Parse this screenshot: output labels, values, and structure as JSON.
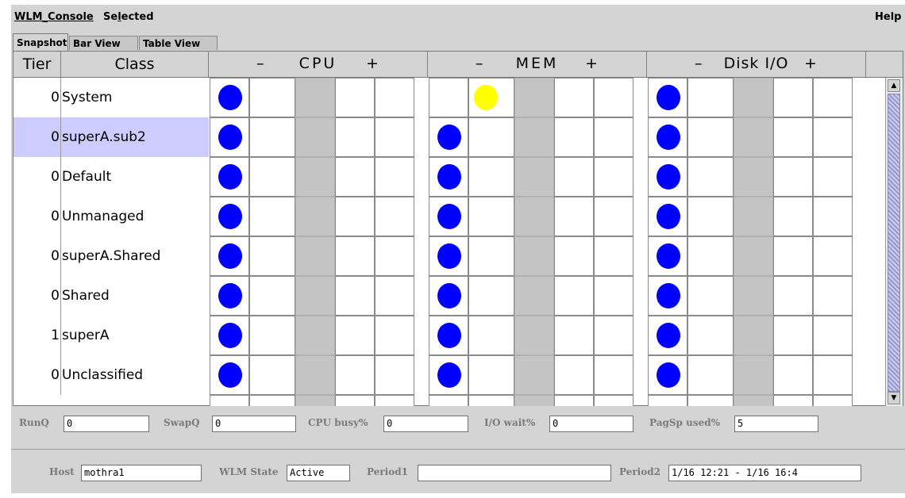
{
  "menubar": {
    "wlm_console": "WLM_Console",
    "selected_pre": "Se",
    "selected_ul": "l",
    "selected_post": "ected",
    "help": "Help"
  },
  "tabs": [
    "Snapshot",
    "Bar View",
    "Table View"
  ],
  "active_tab": "Snapshot",
  "header": {
    "tier": "Tier",
    "class": "Class",
    "groups": [
      {
        "minus": "–",
        "title": "CPU",
        "plus": "+"
      },
      {
        "minus": "–",
        "title": "MEM",
        "plus": "+"
      },
      {
        "minus": "–",
        "title": "Disk I/O",
        "plus": "+"
      }
    ]
  },
  "colors": {
    "blue": "#0000ff",
    "yellow": "#ffff00",
    "selected_row": "#ccccff"
  },
  "rows": [
    {
      "tier": "0",
      "class": "System",
      "selected": false,
      "cpu": {
        "slot": 0,
        "color": "blue"
      },
      "mem": {
        "slot": 1,
        "color": "yellow"
      },
      "disk": {
        "slot": 0,
        "color": "blue"
      }
    },
    {
      "tier": "0",
      "class": "superA.sub2",
      "selected": true,
      "cpu": {
        "slot": 0,
        "color": "blue"
      },
      "mem": {
        "slot": 0,
        "color": "blue"
      },
      "disk": {
        "slot": 0,
        "color": "blue"
      }
    },
    {
      "tier": "0",
      "class": "Default",
      "selected": false,
      "cpu": {
        "slot": 0,
        "color": "blue"
      },
      "mem": {
        "slot": 0,
        "color": "blue"
      },
      "disk": {
        "slot": 0,
        "color": "blue"
      }
    },
    {
      "tier": "0",
      "class": "Unmanaged",
      "selected": false,
      "cpu": {
        "slot": 0,
        "color": "blue"
      },
      "mem": {
        "slot": 0,
        "color": "blue"
      },
      "disk": {
        "slot": 0,
        "color": "blue"
      }
    },
    {
      "tier": "0",
      "class": "superA.Shared",
      "selected": false,
      "cpu": {
        "slot": 0,
        "color": "blue"
      },
      "mem": {
        "slot": 0,
        "color": "blue"
      },
      "disk": {
        "slot": 0,
        "color": "blue"
      }
    },
    {
      "tier": "0",
      "class": "Shared",
      "selected": false,
      "cpu": {
        "slot": 0,
        "color": "blue"
      },
      "mem": {
        "slot": 0,
        "color": "blue"
      },
      "disk": {
        "slot": 0,
        "color": "blue"
      }
    },
    {
      "tier": "1",
      "class": "superA",
      "selected": false,
      "cpu": {
        "slot": 0,
        "color": "blue"
      },
      "mem": {
        "slot": 0,
        "color": "blue"
      },
      "disk": {
        "slot": 0,
        "color": "blue"
      }
    },
    {
      "tier": "0",
      "class": "Unclassified",
      "selected": false,
      "cpu": {
        "slot": 0,
        "color": "blue"
      },
      "mem": {
        "slot": 0,
        "color": "blue"
      },
      "disk": {
        "slot": 0,
        "color": "blue"
      }
    }
  ],
  "stats": {
    "runq": {
      "label": "RunQ",
      "value": "0"
    },
    "swapq": {
      "label": "SwapQ",
      "value": "0"
    },
    "cpubusy": {
      "label": "CPU busy%",
      "value": "0"
    },
    "iowait": {
      "label": "I/O wait%",
      "value": "0"
    },
    "pagsp": {
      "label": "PagSp used%",
      "value": "5"
    }
  },
  "footer": {
    "host": {
      "label": "Host",
      "value": "mothra1"
    },
    "wlmstate": {
      "label": "WLM State",
      "value": "Active"
    },
    "period1": {
      "label": "Period1",
      "value": ""
    },
    "period2": {
      "label": "Period2",
      "value": "1/16 12:21 - 1/16 16:4"
    }
  }
}
